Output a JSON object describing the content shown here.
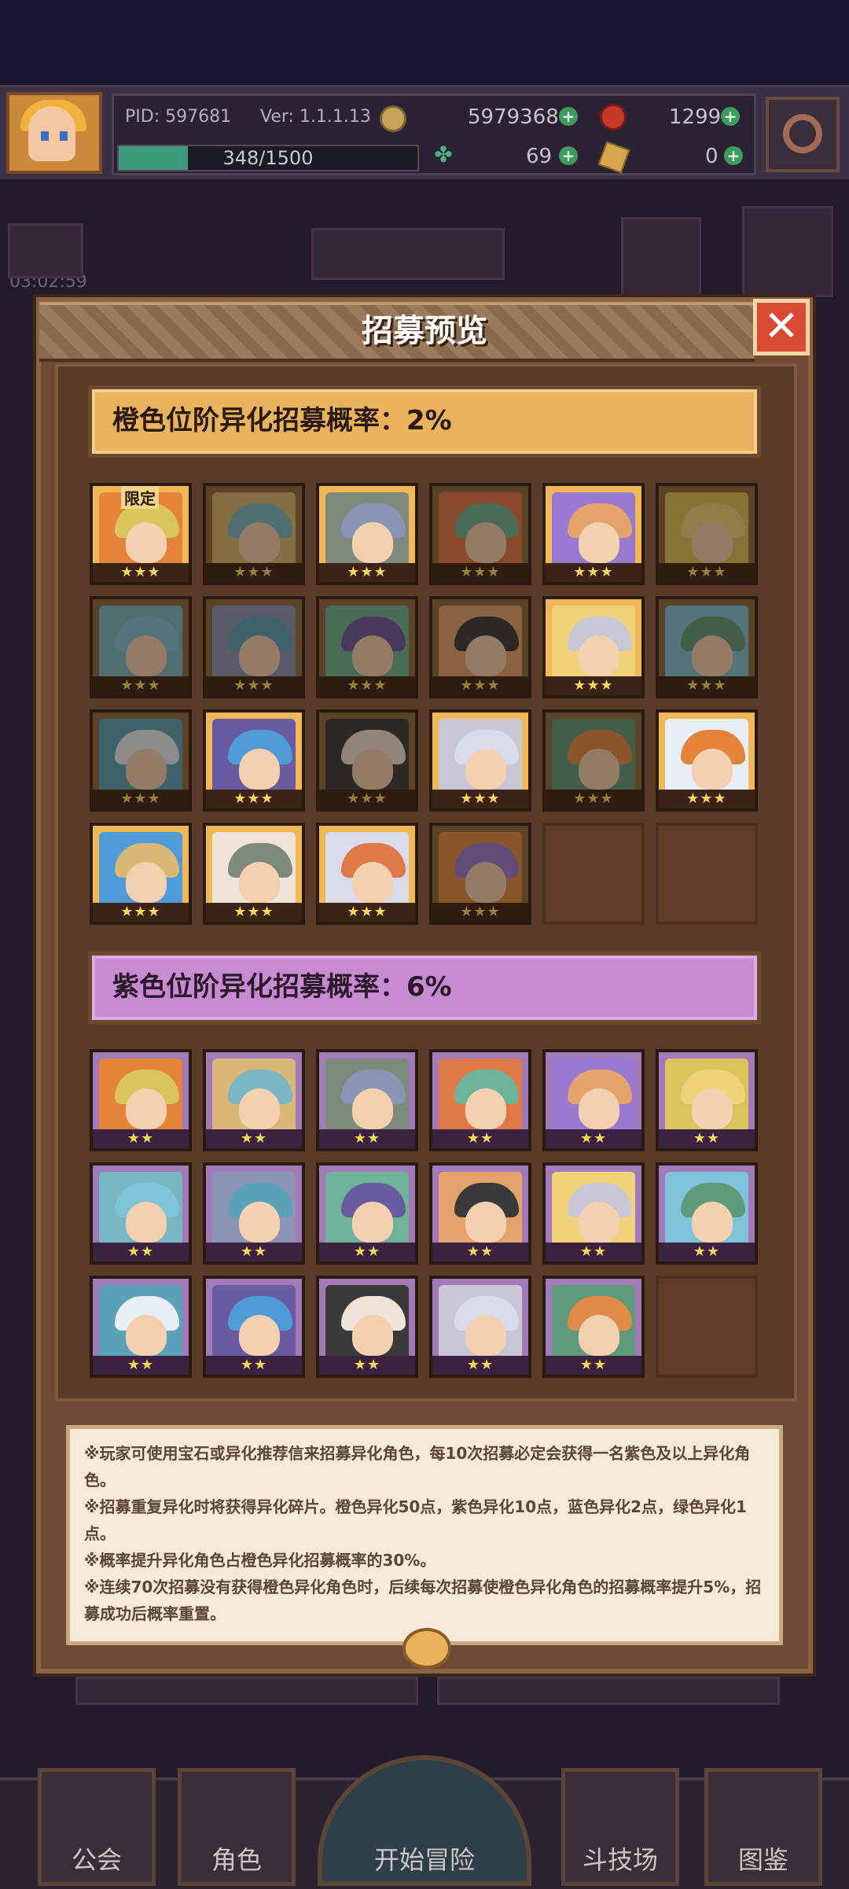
{
  "header": {
    "pid": "PID: 597681",
    "version": "Ver: 1.1.1.13",
    "gold": "5979368",
    "gems": "1299",
    "stamina": "348/1500",
    "clover": "69",
    "tickets": "0",
    "stamina_fraction": 0.232
  },
  "background": {
    "timer": "03:02:59"
  },
  "modal": {
    "title": "招募预览",
    "close_label": "✕",
    "orange_banner": "橙色位阶异化招募概率：2%",
    "purple_banner": "紫色位阶异化招募概率：6%",
    "limited_badge": "限定",
    "three_stars": "★★★",
    "two_stars": "★★",
    "notes": [
      "※玩家可使用宝石或异化推荐信来招募异化角色，每10次招募必定会获得一名紫色及以上异化角色。",
      "※招募重复异化时将获得异化碎片。橙色异化50点，紫色异化10点，蓝色异化2点，绿色异化1点。",
      "※概率提升异化角色占橙色异化招募概率的30%。",
      "※连续70次招募没有获得橙色异化角色时，后续每次招募使橙色异化角色的招募概率提升5%，招募成功后概率重置。"
    ]
  },
  "nav": {
    "guild": "公会",
    "characters": "角色",
    "start": "开始冒险",
    "arena": "斗技场",
    "codex": "图鉴"
  },
  "colors": {
    "orange_card": "#f0b759",
    "purple_card": "#a27ab8",
    "banner_orange": "#e9b25c",
    "banner_purple": "#c88ad2",
    "close_button": "#d94a33"
  }
}
